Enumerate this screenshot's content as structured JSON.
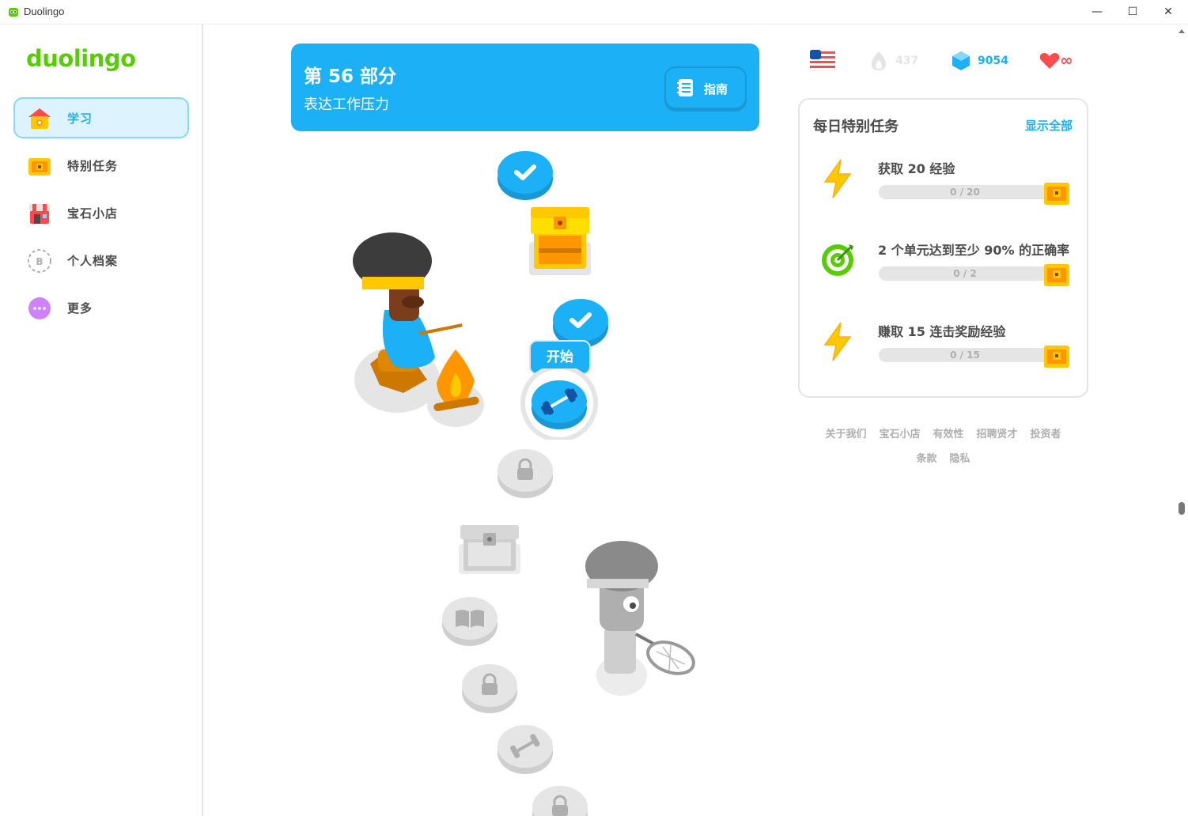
{
  "window": {
    "title": "Duolingo",
    "minimize_glyph": "—",
    "maximize_glyph": "☐",
    "close_glyph": "✕"
  },
  "sidebar": {
    "logo": "duolingo",
    "items": [
      {
        "label": "学习",
        "icon": "home-icon",
        "active": true
      },
      {
        "label": "特别任务",
        "icon": "quests-chest-icon",
        "active": false
      },
      {
        "label": "宝石小店",
        "icon": "shop-icon",
        "active": false
      },
      {
        "label": "个人档案",
        "icon": "profile-avatar-icon",
        "active": false,
        "avatar_letter": "B"
      },
      {
        "label": "更多",
        "icon": "more-icon",
        "active": false
      }
    ]
  },
  "unit": {
    "title": "第 56 部分",
    "subtitle": "表达工作压力",
    "guide_label": "指南"
  },
  "path": {
    "start_label": "开始",
    "nodes": [
      {
        "type": "completed",
        "icon": "check-icon"
      },
      {
        "type": "chest-open",
        "icon": "treasure-chest-icon"
      },
      {
        "type": "completed",
        "icon": "check-icon"
      },
      {
        "type": "current",
        "icon": "dumbbell-icon"
      },
      {
        "type": "locked",
        "icon": "lock-icon"
      },
      {
        "type": "chest-locked",
        "icon": "treasure-chest-icon"
      },
      {
        "type": "locked",
        "icon": "book-icon"
      },
      {
        "type": "locked",
        "icon": "lock-icon"
      },
      {
        "type": "locked",
        "icon": "dumbbell-icon"
      },
      {
        "type": "locked",
        "icon": "lock-icon"
      }
    ]
  },
  "stats": {
    "language_flag": "us-flag-icon",
    "streak": "437",
    "gems": "9054",
    "hearts": "∞"
  },
  "daily_quests": {
    "title": "每日特别任务",
    "view_all": "显示全部",
    "quests": [
      {
        "title": "获取 20 经验",
        "progress": "0 / 20",
        "icon": "lightning-icon",
        "fraction": 0
      },
      {
        "title": "2 个单元达到至少 90% 的正确率",
        "progress": "0 / 2",
        "icon": "target-icon",
        "fraction": 0
      },
      {
        "title": "赚取 15 连击奖励经验",
        "progress": "0 / 15",
        "icon": "lightning-icon",
        "fraction": 0
      }
    ]
  },
  "footer": {
    "links": [
      "关于我们",
      "宝石小店",
      "有效性",
      "招聘贤才",
      "投资者",
      "条款",
      "隐私"
    ]
  },
  "colors": {
    "brand_green": "#58cc02",
    "brand_blue": "#1cb0f6",
    "locked_gray": "#e5e5e5"
  }
}
